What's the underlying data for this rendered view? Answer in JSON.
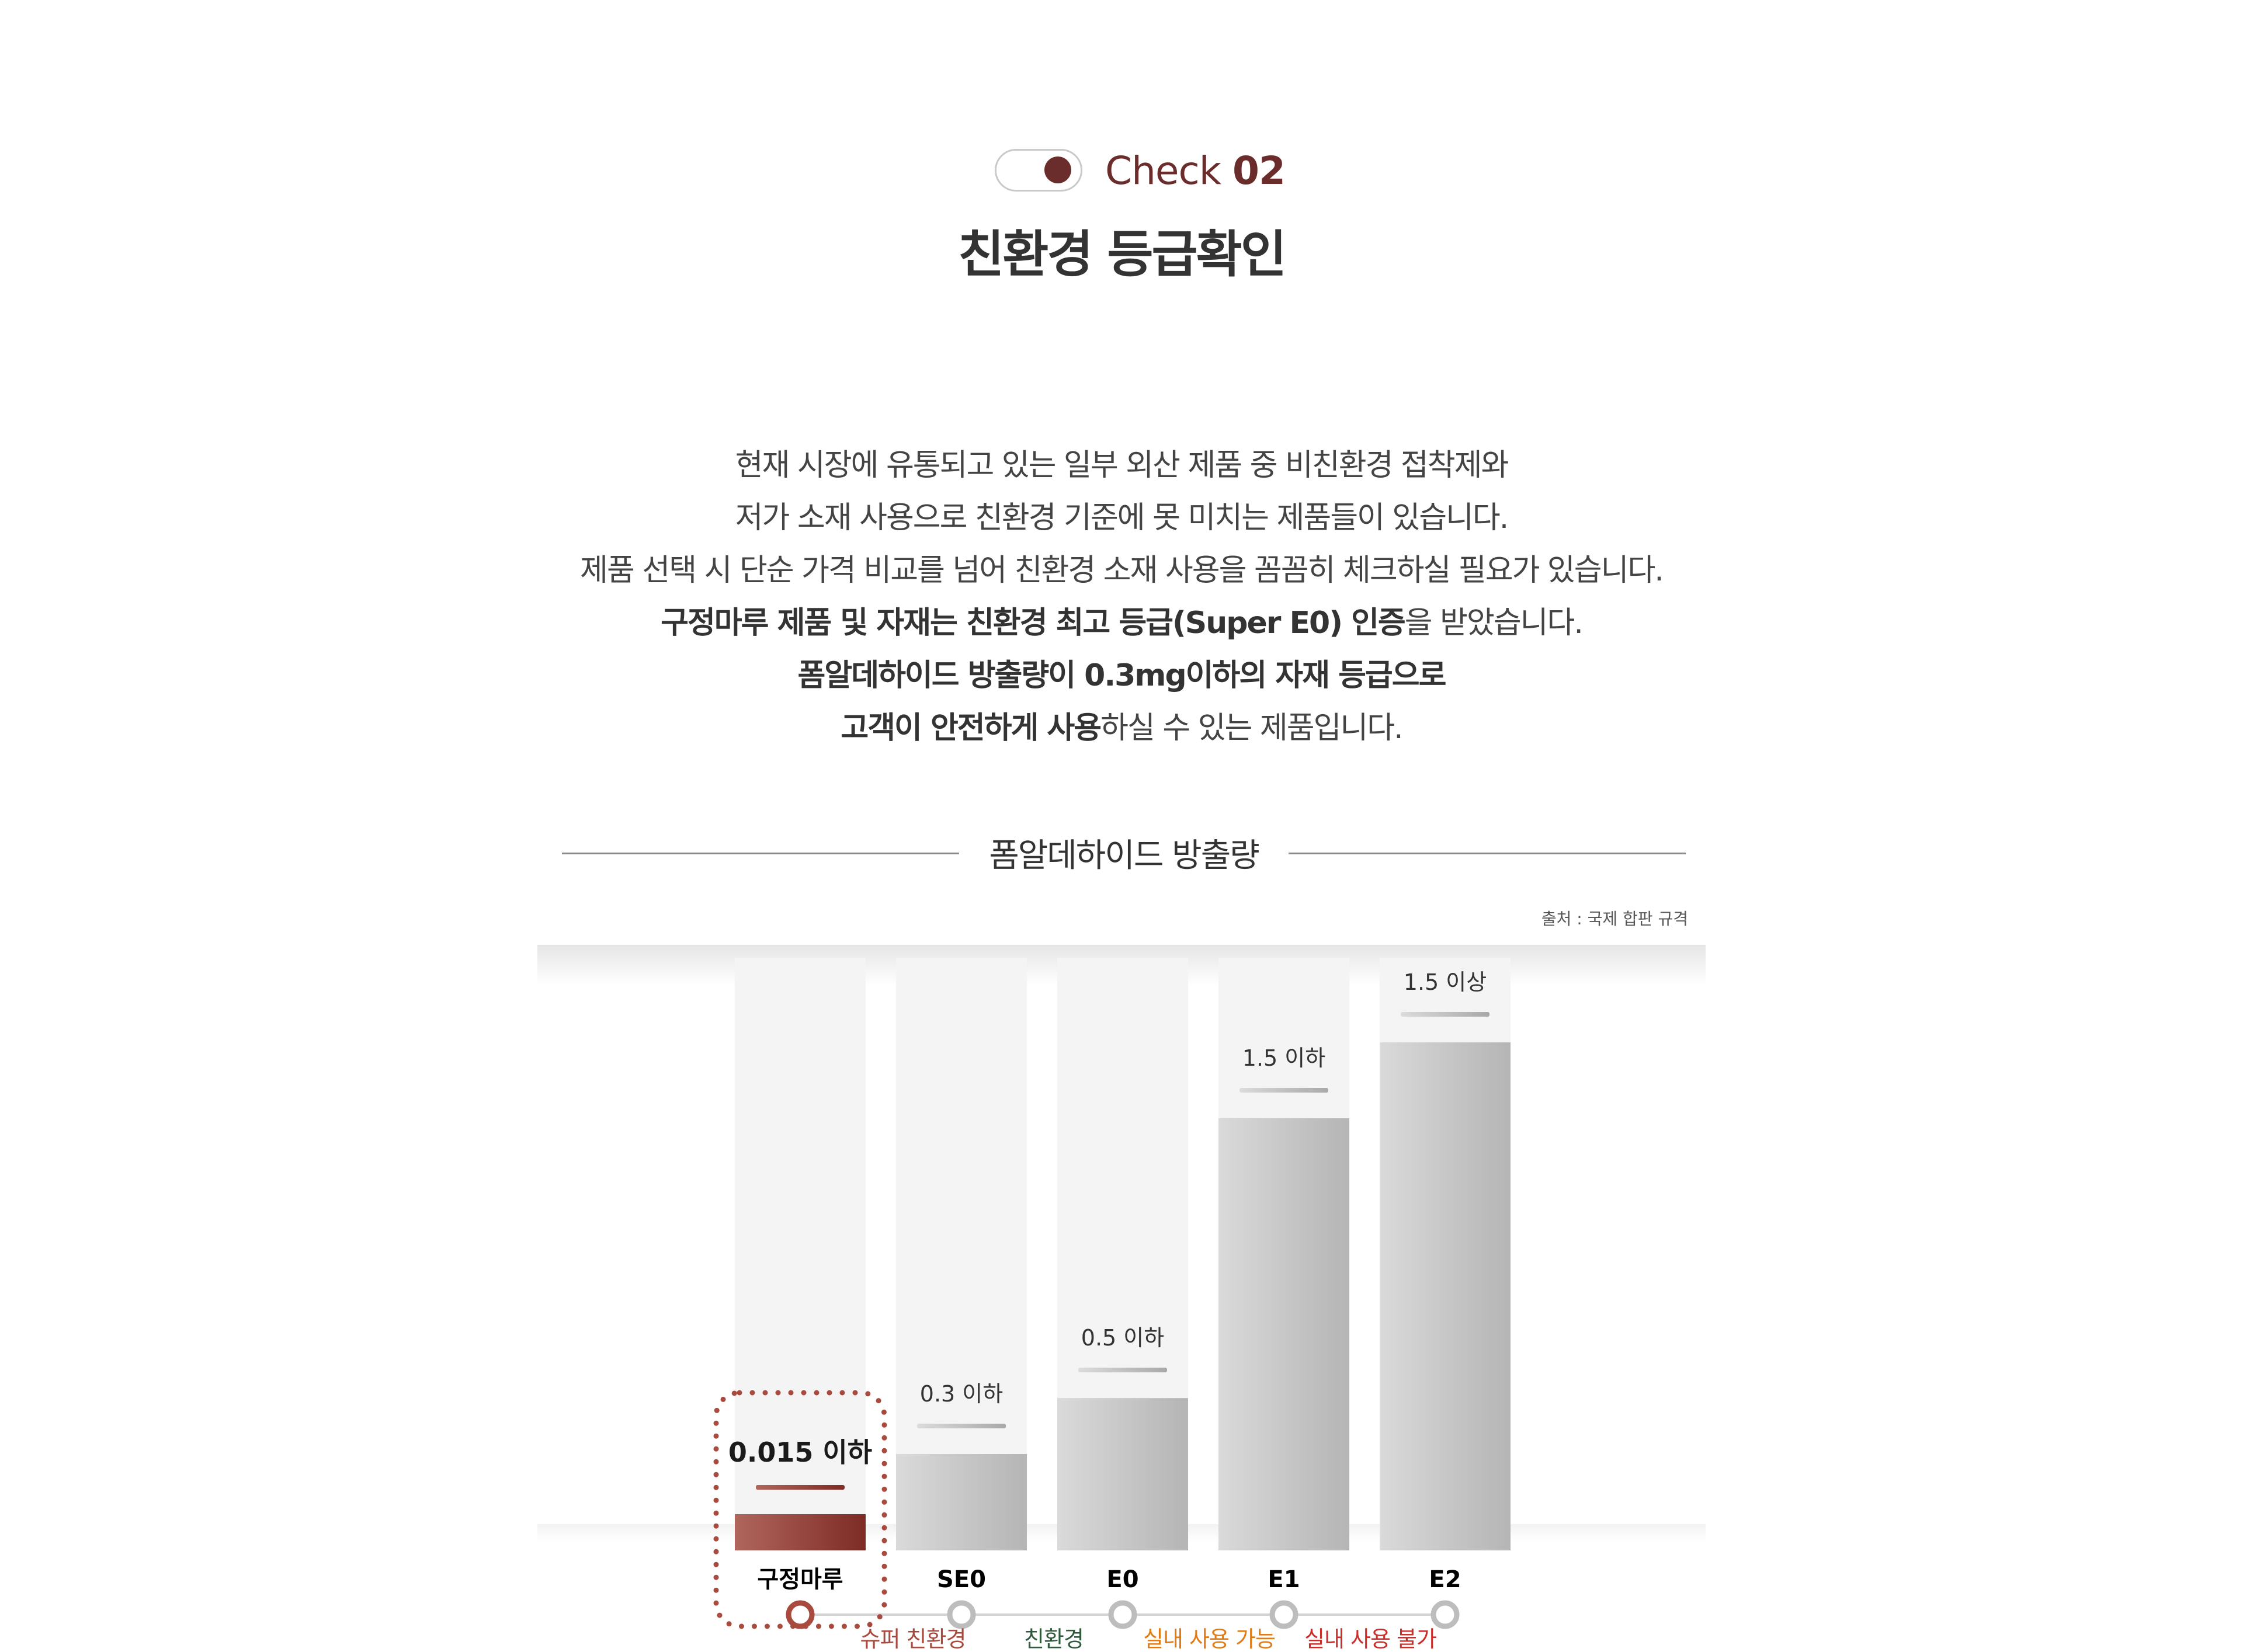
{
  "header": {
    "check_word": "Check",
    "check_number": "02",
    "title": "친환경 등급확인"
  },
  "description": {
    "line1": "현재 시장에 유통되고 있는 일부 외산 제품 중 비친환경 접착제와",
    "line2": "저가 소재 사용으로 친환경 기준에 못 미치는 제품들이 있습니다.",
    "line3": "제품 선택 시 단순 가격 비교를 넘어 친환경 소재 사용을 꼼꼼히 체크하실 필요가 있습니다.",
    "line4_bold": "구정마루 제품 및 자재는 친환경 최고 등급(Super E0) 인증",
    "line4_rest": "을 받았습니다.",
    "line5_bold": "폼알데하이드 방출량이 0.3mg이하의 자재 등급으로",
    "line6_bold": "고객이 안전하게 사용",
    "line6_rest": "하실 수 있는 제품입니다."
  },
  "chart_data": {
    "type": "bar",
    "title": "폼알데하이드 방출량",
    "source": "출처 : 국제 합판 규격",
    "categories": [
      "구정마루",
      "SE0",
      "E0",
      "E1",
      "E2"
    ],
    "values": [
      0.015,
      0.3,
      0.5,
      1.5,
      1.5
    ],
    "data_labels": [
      "0.015 이하",
      "0.3 이하",
      "0.5 이하",
      "1.5 이하",
      "1.5 이상"
    ],
    "highlight_index": 0,
    "grades": [
      {
        "label": "슈퍼 친환경",
        "color": "#a84a3d"
      },
      {
        "label": "친환경",
        "color": "#2f5a3c"
      },
      {
        "label": "실내 사용 가능",
        "color": "#e07b16"
      },
      {
        "label": "실내 사용 불가",
        "color": "#c9302c"
      }
    ],
    "colors": {
      "highlight": "#8d3a32",
      "bar": "#cfcfcf",
      "track": "#f4f4f4",
      "marker_default": "#bdbdbd",
      "marker_highlight": "#a84a3d"
    }
  }
}
